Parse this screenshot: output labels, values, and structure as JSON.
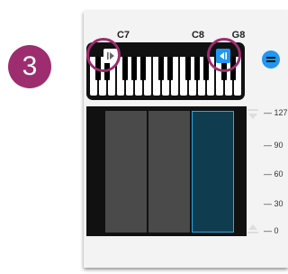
{
  "step_number": "3",
  "note_labels": {
    "c7": "C7",
    "c8": "C8",
    "g8": "G8"
  },
  "velocity_scale": [
    "127",
    "90",
    "60",
    "30",
    "0"
  ],
  "icons": {
    "left_handle": "play-triangle-right-icon",
    "right_handle": "play-triangle-left-icon",
    "zoom": "equals-icon",
    "scroll_up": "triangle-down-icon",
    "scroll_down": "triangle-up-icon"
  },
  "colors": {
    "badge": "#9d2d6f",
    "accent": "#2196f3",
    "selected_lane": "#0f3d4f",
    "selected_border": "#2aa9e0"
  }
}
